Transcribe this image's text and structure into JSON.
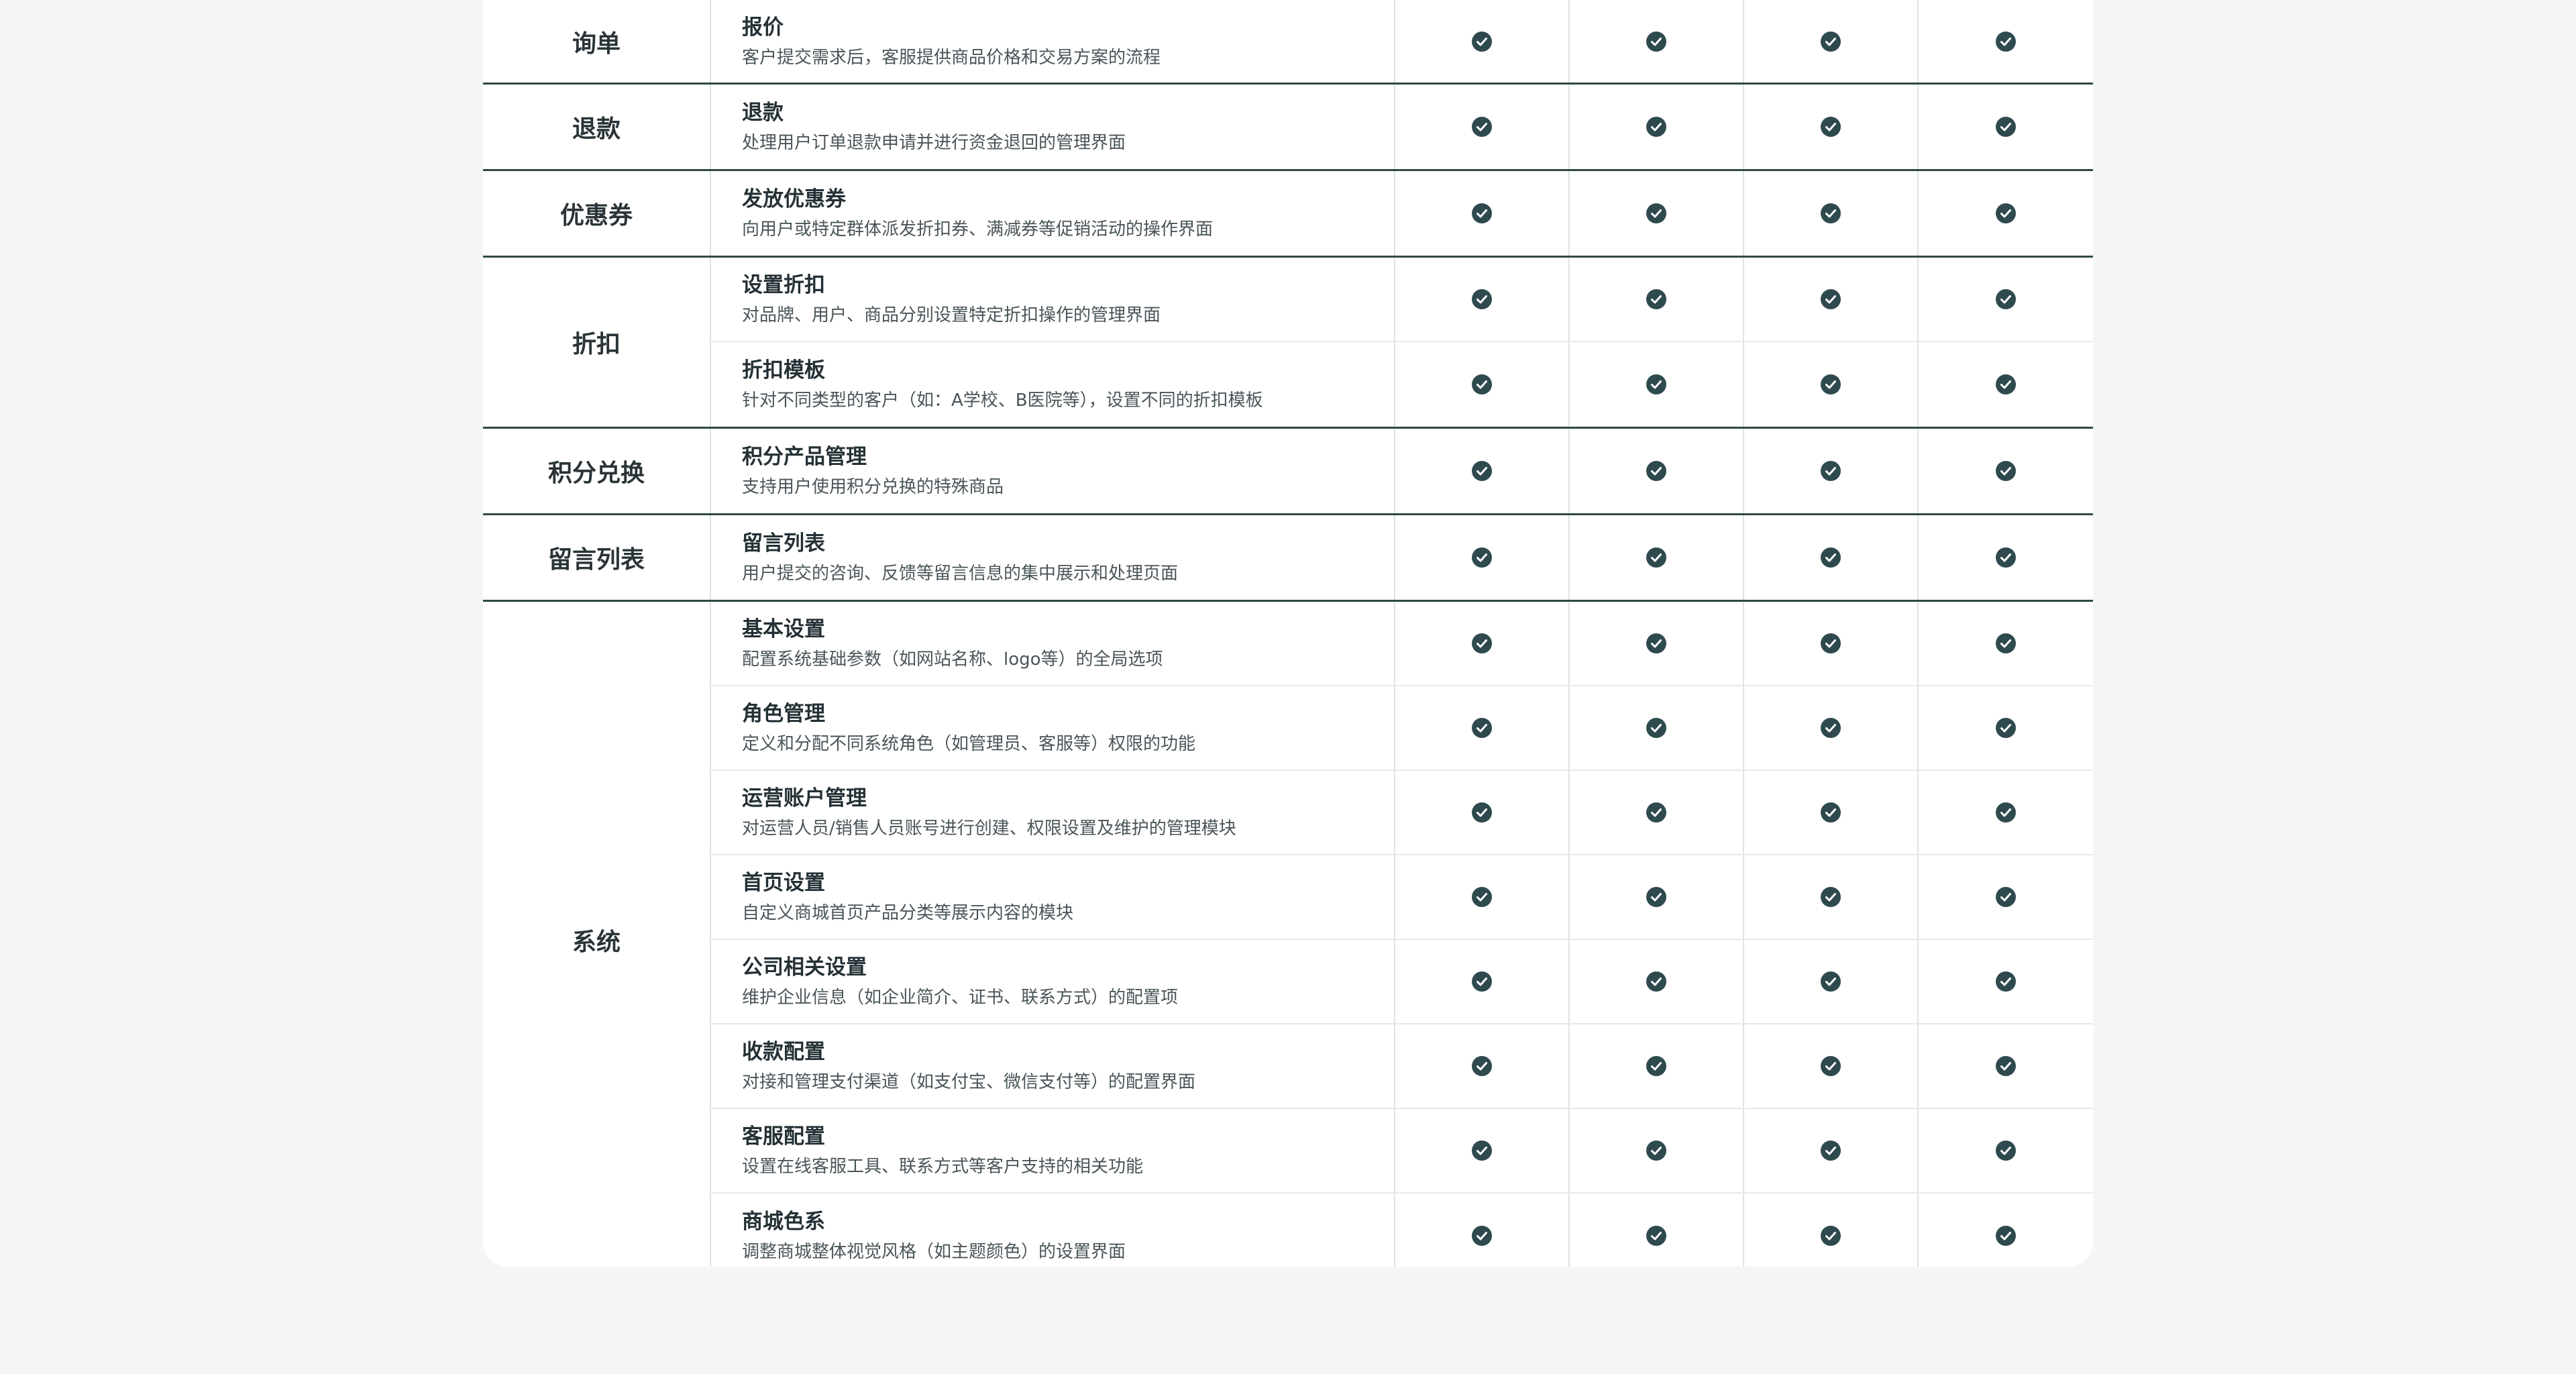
{
  "colors": {
    "background": "#f3f5f7",
    "card": "#ffffff",
    "group_divider": "#2f4a45",
    "check_fill": "#2f4a4f"
  },
  "icon": "check-circle-icon",
  "plan_columns": 4,
  "groups": [
    {
      "category": "询单",
      "features": [
        {
          "title": "报价",
          "desc": "客户提交需求后，客服提供商品价格和交易方案的流程"
        }
      ]
    },
    {
      "category": "退款",
      "features": [
        {
          "title": "退款",
          "desc": "处理用户订单退款申请并进行资金退回的管理界面"
        }
      ]
    },
    {
      "category": "优惠券",
      "features": [
        {
          "title": "发放优惠券",
          "desc": "向用户或特定群体派发折扣券、满减券等促销活动的操作界面"
        }
      ]
    },
    {
      "category": "折扣",
      "features": [
        {
          "title": "设置折扣",
          "desc": "对品牌、用户、商品分别设置特定折扣操作的管理界面"
        },
        {
          "title": "折扣模板",
          "desc": "针对不同类型的客户（如：A学校、B医院等），设置不同的折扣模板"
        }
      ]
    },
    {
      "category": "积分兑换",
      "features": [
        {
          "title": "积分产品管理",
          "desc": "支持用户使用积分兑换的特殊商品"
        }
      ]
    },
    {
      "category": "留言列表",
      "features": [
        {
          "title": "留言列表",
          "desc": "用户提交的咨询、反馈等留言信息的集中展示和处理页面"
        }
      ]
    },
    {
      "category": "系统",
      "features": [
        {
          "title": "基本设置",
          "desc": "配置系统基础参数（如网站名称、logo等）的全局选项"
        },
        {
          "title": "角色管理",
          "desc": "定义和分配不同系统角色（如管理员、客服等）权限的功能"
        },
        {
          "title": "运营账户管理",
          "desc": "对运营人员/销售人员账号进行创建、权限设置及维护的管理模块"
        },
        {
          "title": "首页设置",
          "desc": "自定义商城首页产品分类等展示内容的模块"
        },
        {
          "title": "公司相关设置",
          "desc": "维护企业信息（如企业简介、证书、联系方式）的配置项"
        },
        {
          "title": "收款配置",
          "desc": "对接和管理支付渠道（如支付宝、微信支付等）的配置界面"
        },
        {
          "title": "客服配置",
          "desc": "设置在线客服工具、联系方式等客户支持的相关功能"
        },
        {
          "title": "商城色系",
          "desc": "调整商城整体视觉风格（如主题颜色）的设置界面"
        }
      ]
    }
  ]
}
